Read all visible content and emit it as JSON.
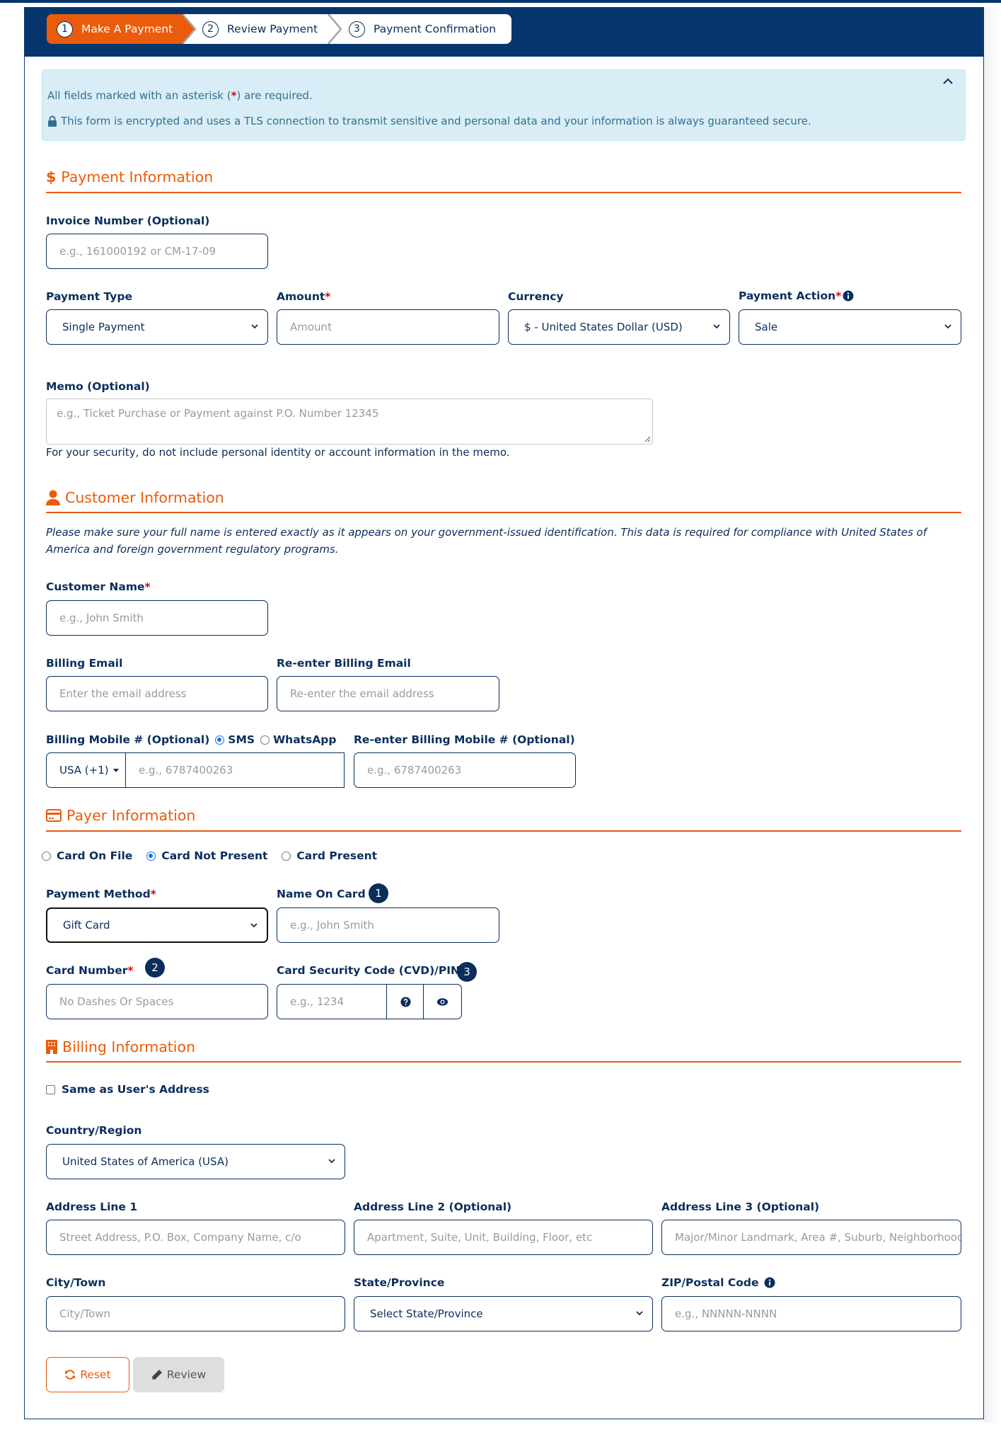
{
  "stepper": {
    "steps": [
      {
        "num": "1",
        "label": "Make A Payment",
        "active": true
      },
      {
        "num": "2",
        "label": "Review Payment",
        "active": false
      },
      {
        "num": "3",
        "label": "Payment Confirmation",
        "active": false
      }
    ]
  },
  "info": {
    "required_prefix": "All fields marked with an asterisk (",
    "required_star": "*",
    "required_suffix": ") are required.",
    "secure_text": "This form is encrypted and uses a TLS connection to transmit sensitive and personal data and your information is always guaranteed secure."
  },
  "payment_info": {
    "title": "Payment Information",
    "invoice": {
      "label": "Invoice Number (Optional)",
      "placeholder": "e.g., 161000192 or CM-17-09"
    },
    "payment_type": {
      "label": "Payment Type",
      "value": "Single Payment"
    },
    "amount": {
      "label": "Amount",
      "required": "*",
      "placeholder": "Amount"
    },
    "currency": {
      "label": "Currency",
      "value": "$ - United States Dollar (USD)"
    },
    "payment_action": {
      "label": "Payment Action",
      "required": "*",
      "value": "Sale"
    },
    "memo": {
      "label": "Memo (Optional)",
      "placeholder": "e.g., Ticket Purchase or Payment against P.O. Number 12345",
      "help": "For your security, do not include personal identity or account information in the memo."
    }
  },
  "customer_info": {
    "title": "Customer Information",
    "note_line1": "Please make sure your full name is entered exactly as it appears on your government-issued identification. This data is required for compliance with United States of",
    "note_line2": "America and foreign government regulatory programs.",
    "customer_name": {
      "label": "Customer Name",
      "required": "*",
      "placeholder": "e.g., John Smith"
    },
    "billing_email": {
      "label": "Billing Email",
      "placeholder": "Enter the email address"
    },
    "reenter_email": {
      "label": "Re-enter Billing Email",
      "placeholder": "Re-enter the email address"
    },
    "billing_mobile": {
      "label": "Billing Mobile # (Optional)",
      "sms_label": "SMS",
      "whatsapp_label": "WhatsApp",
      "selected_channel": "SMS",
      "country_code": "USA (+1)",
      "placeholder": "e.g., 6787400263"
    },
    "reenter_mobile": {
      "label": "Re-enter Billing Mobile # (Optional)",
      "placeholder": "e.g., 6787400263"
    }
  },
  "payer_info": {
    "title": "Payer Information",
    "card_modes": [
      {
        "label": "Card On File",
        "selected": false
      },
      {
        "label": "Card Not Present",
        "selected": true
      },
      {
        "label": "Card Present",
        "selected": false
      }
    ],
    "payment_method": {
      "label": "Payment Method",
      "required": "*",
      "value": "Gift Card"
    },
    "name_on_card": {
      "label": "Name On Card",
      "placeholder": "e.g., John Smith",
      "badge": "1"
    },
    "card_number": {
      "label": "Card Number",
      "required": "*",
      "placeholder": "No Dashes Or Spaces",
      "badge": "2"
    },
    "security_code": {
      "label": "Card Security Code (CVD)/PIN",
      "required": "*",
      "placeholder": "e.g., 1234",
      "badge": "3"
    }
  },
  "billing_info": {
    "title": "Billing Information",
    "same_as_user": {
      "label": "Same as User's Address",
      "checked": false
    },
    "country": {
      "label": "Country/Region",
      "value": "United States of America (USA)"
    },
    "address1": {
      "label": "Address Line 1",
      "placeholder": "Street Address, P.O. Box, Company Name, c/o"
    },
    "address2": {
      "label": "Address Line 2 (Optional)",
      "placeholder": "Apartment, Suite, Unit, Building, Floor, etc"
    },
    "address3": {
      "label": "Address Line 3 (Optional)",
      "placeholder": "Major/Minor Landmark, Area #, Suburb, Neighborhood"
    },
    "city": {
      "label": "City/Town",
      "placeholder": "City/Town"
    },
    "state": {
      "label": "State/Province",
      "value": "Select State/Province"
    },
    "zip": {
      "label": "ZIP/Postal Code",
      "placeholder": "e.g., NNNNN-NNNN"
    }
  },
  "actions": {
    "reset_label": "Reset",
    "review_label": "Review"
  },
  "colors": {
    "brand_navy": "#07366f",
    "accent_orange": "#ea5b0c",
    "required_red": "#e00000",
    "info_bg": "#d9edf7",
    "info_text": "#31708f"
  }
}
